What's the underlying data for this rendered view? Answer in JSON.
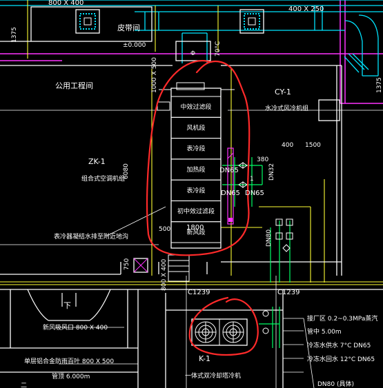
{
  "colors": {
    "background": "#000000",
    "wall": "#ffffff",
    "duct_cyan": "#00e5ff",
    "pipe_magenta": "#ff33ff",
    "pipe_green": "#00ff66",
    "pipe_blue": "#3355ff",
    "dim_yellow": "#ffff33",
    "annotation_red": "#ff2a2a"
  },
  "top": {
    "duct_size_left": "800 X 400",
    "duct_size_right": "400 X 250",
    "dim_1375_left": "1375",
    "dim_1375_right": "1375",
    "room_label": "皮带间",
    "elevation": "±0.000",
    "phi_symbol": "Φ",
    "temp_label": "70°C"
  },
  "left": {
    "room_name": "公用工程间",
    "unit_tag": "ZK-1",
    "unit_desc": "组合式空调机组",
    "dim_6080": "6080",
    "dim_750": "750",
    "note_water": "表冷器凝结水排至附近地沟",
    "dim_500": "500"
  },
  "ahu": {
    "dim_top": "1000 X 500",
    "sections": [
      "中效过滤段",
      "风机段",
      "表冷段",
      "加热段",
      "表冷段",
      "初中效过滤段",
      "新风段"
    ],
    "dim_width": "1800"
  },
  "right": {
    "tag_cy": "CY-1",
    "desc_cy": "水冷式风冷机组",
    "dim_400": "400",
    "dim_1500": "1500",
    "dim_380": "380",
    "pipe_dn65_a": "DN65",
    "pipe_dn65_b": "DN65",
    "pipe_dn65_c": "DN65",
    "pipe_dn32": "DN32",
    "pipe_dn80": "DN80",
    "dim_1": "1"
  },
  "axes": {
    "c1239_left": "C1239",
    "c1239_right": "C1239"
  },
  "bottom": {
    "vent_label": "下",
    "duct_note": "新风吸风口 800 X 400",
    "louver_note": "单层铝合金防雨百叶 800 X 500",
    "louver_height": "管顶 6.000m",
    "fan_tag": "K-1",
    "fan_desc": "一体式双冷却塔冷机",
    "dim_800_400": "800 X 400",
    "pressure_note": "接厂区 0.2~0.3MPa蒸汽",
    "pipe_height": "管中 5.00m",
    "chw_supply": "冷冻水供水 7°C DN65",
    "chw_return": "冷冻水回水 12°C DN65",
    "cut_text": "DN80 (具体)",
    "footer_mark": "二"
  }
}
